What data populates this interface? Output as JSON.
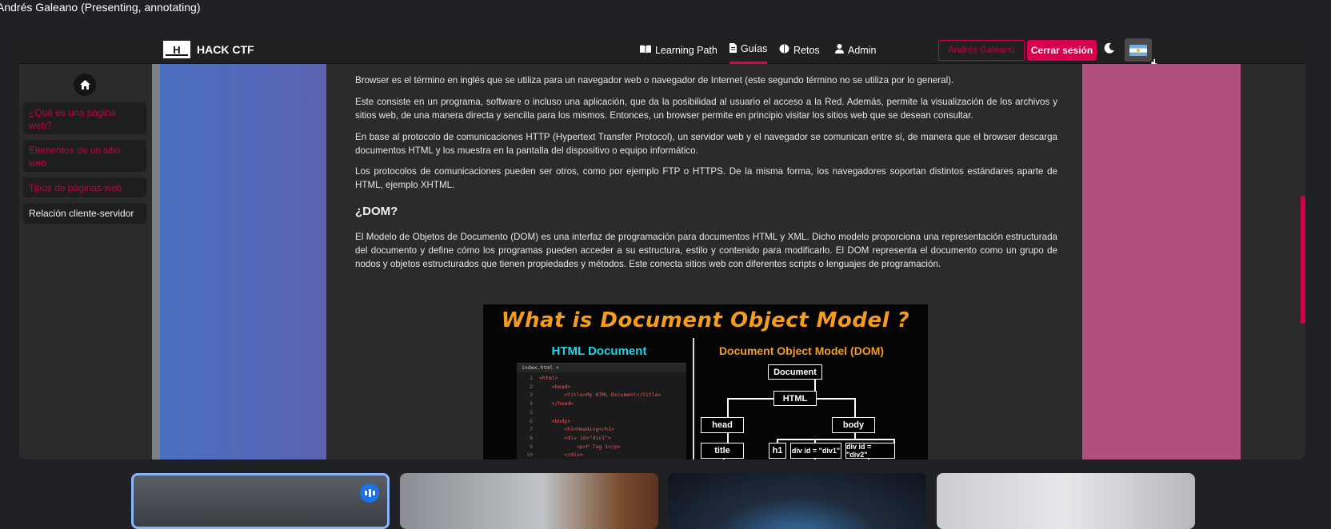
{
  "meeting": {
    "presenter_label": "Andrés Galeano (Presenting, annotating)"
  },
  "navbar": {
    "brand_logo": "H",
    "brand_name": "HACK CTF",
    "items": [
      {
        "label": "Learning Path",
        "icon": "book-icon"
      },
      {
        "label": "Guías",
        "icon": "document-icon",
        "active": true
      },
      {
        "label": "Retos",
        "icon": "brain-icon"
      },
      {
        "label": "Admin",
        "icon": "user-tie-icon"
      }
    ],
    "user_label": "Andrés Galeano",
    "logout_label": "Cerrar sesión",
    "theme_icon": "moon-icon",
    "language_flag": "argentina-flag-icon"
  },
  "sidebar": {
    "home_icon": "home-icon",
    "items": [
      {
        "label": "¿Qué es una página web?"
      },
      {
        "label": "Elementos de un sitio web"
      },
      {
        "label": "Tipos de páginas web"
      },
      {
        "label": "Relación cliente-servidor",
        "current": true
      }
    ]
  },
  "content": {
    "paragraphs": [
      "Browser es el término en inglés que se utiliza para un navegador web o navegador de Internet (este segundo término no se utiliza por lo general).",
      "Este consiste en un programa, software o incluso una aplicación, que da la posibilidad al usuario el acceso a la Red. Además, permite la visualización de los archivos y sitios web, de una manera directa y sencilla para los mismos. Entonces, un browser permite en principio visitar los sitios web que se desean consultar.",
      "En base al protocolo de comunicaciones HTTP (Hypertext Transfer Protocol), un servidor web y el navegador se comunican entre sí, de manera que el browser descarga documentos HTML y los muestra en la pantalla del dispositivo o equipo informático.",
      "Los protocolos de comunicaciones pueden ser otros, como por ejemplo FTP o HTTPS. De la misma forma, los navegadores soportan distintos estándares aparte de HTML, ejemplo XHTML."
    ],
    "dom_heading": "¿DOM?",
    "dom_paragraph": "El Modelo de Objetos de Documento (DOM) es una interfaz de programación para documentos HTML y XML. Dicho modelo proporciona una representación estructurada del documento y define cómo los programas pueden acceder a su estructura, estilo y contenido para modificarlo. El DOM representa el documento como un grupo de nodos y objetos estructurados que tienen propiedades y métodos. Este conecta sitios web con diferentes scripts o lenguajes de programación.",
    "figure": {
      "title": "What is Document Object Model ?",
      "left_label": "HTML Document",
      "right_label": "Document Object Model (DOM)",
      "editor_tab": "index.html  ×",
      "code_lines": [
        {
          "n": "1",
          "text": "<html>"
        },
        {
          "n": "2",
          "text": "    <head>"
        },
        {
          "n": "3",
          "text": "        <title>My HTML Document</title>"
        },
        {
          "n": "4",
          "text": "    </head>"
        },
        {
          "n": "5",
          "text": ""
        },
        {
          "n": "6",
          "text": "    <body>"
        },
        {
          "n": "7",
          "text": "        <h1>Heading</h1>"
        },
        {
          "n": "8",
          "text": "        <div id=\"div1\">"
        },
        {
          "n": "9",
          "text": "            <p>P Tag 1</p>"
        },
        {
          "n": "10",
          "text": "        </div>"
        }
      ],
      "tree_nodes": {
        "document": "Document",
        "html": "HTML",
        "head": "head",
        "body": "body",
        "title": "title",
        "h1": "h1",
        "div1": "div id = \"div1\"",
        "div2": "div id = \"div2\""
      }
    }
  },
  "participants": [
    {
      "name": "participant-1",
      "speaking": true
    },
    {
      "name": "participant-2"
    },
    {
      "name": "participant-3"
    },
    {
      "name": "participant-4"
    }
  ],
  "colors": {
    "accent": "#d8004d",
    "sidebar_link": "#c4003d",
    "left_panel": "#4f69b8",
    "right_panel": "#b0507f",
    "figure_orange": "#f39c1e",
    "figure_cyan": "#1fd3e6"
  }
}
